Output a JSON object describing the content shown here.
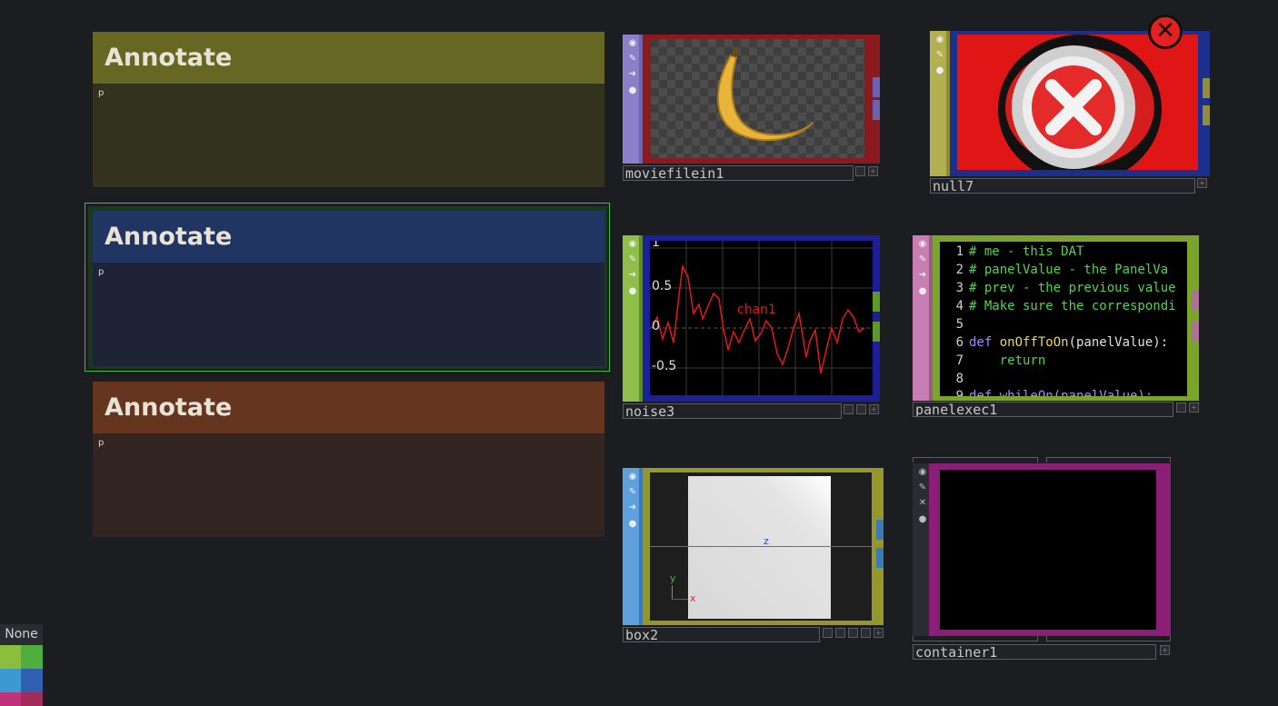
{
  "annotations": [
    {
      "title": "Annotate",
      "body": "p",
      "head_color": "#676724",
      "body_color": "#32321f"
    },
    {
      "title": "Annotate",
      "body": "p",
      "head_color": "#213563",
      "body_color": "#1e2435",
      "selected": true
    },
    {
      "title": "Annotate",
      "body": "p",
      "head_color": "#663520",
      "body_color": "#332521"
    }
  ],
  "nodes": {
    "moviefilein1": {
      "label": "moviefilein1",
      "type": "TOP",
      "content": "banana image"
    },
    "null7": {
      "label": "null7",
      "type": "TOP",
      "content": "error close icon"
    },
    "noise3": {
      "label": "noise3",
      "type": "CHOP",
      "chart": {
        "channel": "chan1",
        "ticks": [
          "1",
          "0.5",
          "0",
          "-0.5"
        ]
      }
    },
    "panelexec1": {
      "label": "panelexec1",
      "type": "DAT",
      "lines": [
        {
          "n": "1",
          "text": "# me - this DAT"
        },
        {
          "n": "2",
          "text": "# panelValue - the PanelVa"
        },
        {
          "n": "3",
          "text": "# prev - the previous value"
        },
        {
          "n": "4",
          "text": "# Make sure the correspondi"
        },
        {
          "n": "5",
          "text": ""
        },
        {
          "n": "6",
          "kw": "def ",
          "fn": "onOffToOn",
          "rest": "(panelValue):"
        },
        {
          "n": "7",
          "kw": "    return",
          "fn": "",
          "rest": ""
        },
        {
          "n": "8",
          "text": ""
        },
        {
          "n": "9",
          "text": "def whileOn(panelValue):"
        }
      ]
    },
    "box2": {
      "label": "box2",
      "type": "SOP",
      "axes": {
        "x": "x",
        "y": "y",
        "z": "z"
      }
    },
    "container1": {
      "label": "container1",
      "type": "COMP"
    }
  },
  "color_palette": {
    "label": "None",
    "colors": [
      "#8bbe3c",
      "#4fae3e",
      "#3d9ad1",
      "#2f5fb3",
      "#c0327c",
      "#a32b5a"
    ]
  },
  "colors": {
    "background": "#1b1d21",
    "top_border": "#8a1a1e",
    "chop_border": "#1b1f9a",
    "dat_border": "#7aa52a",
    "sop_border": "#94972a",
    "comp_border": "#8a1f78",
    "selection": "#3fbf3f"
  }
}
